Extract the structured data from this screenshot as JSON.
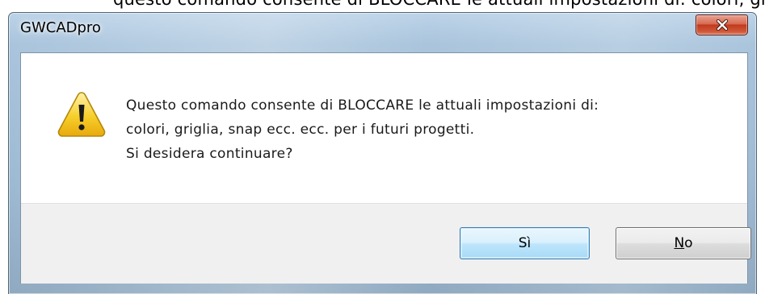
{
  "background_text": "questo comando consente di BLOCCARE le attuali impostazioni di: colori, griglia, snap ecc. ecc. per i futuri progetti",
  "dialog": {
    "title": "GWCADpro",
    "close_label": "X",
    "icon": "warning-icon",
    "message_lines": [
      "Questo comando consente di BLOCCARE le attuali impostazioni di:",
      "colori, griglia, snap ecc. ecc. per i futuri progetti.",
      "Si desidera continuare?"
    ],
    "buttons": {
      "yes_label": "Sì",
      "no_mnemonic": "N",
      "no_rest": "o"
    }
  },
  "colors": {
    "frame": "#a9c4dc",
    "close_button": "#c1391d",
    "button_area": "#f0f0f0",
    "warning_fill": "#f5c518",
    "default_button_border": "#3c7fb1"
  }
}
